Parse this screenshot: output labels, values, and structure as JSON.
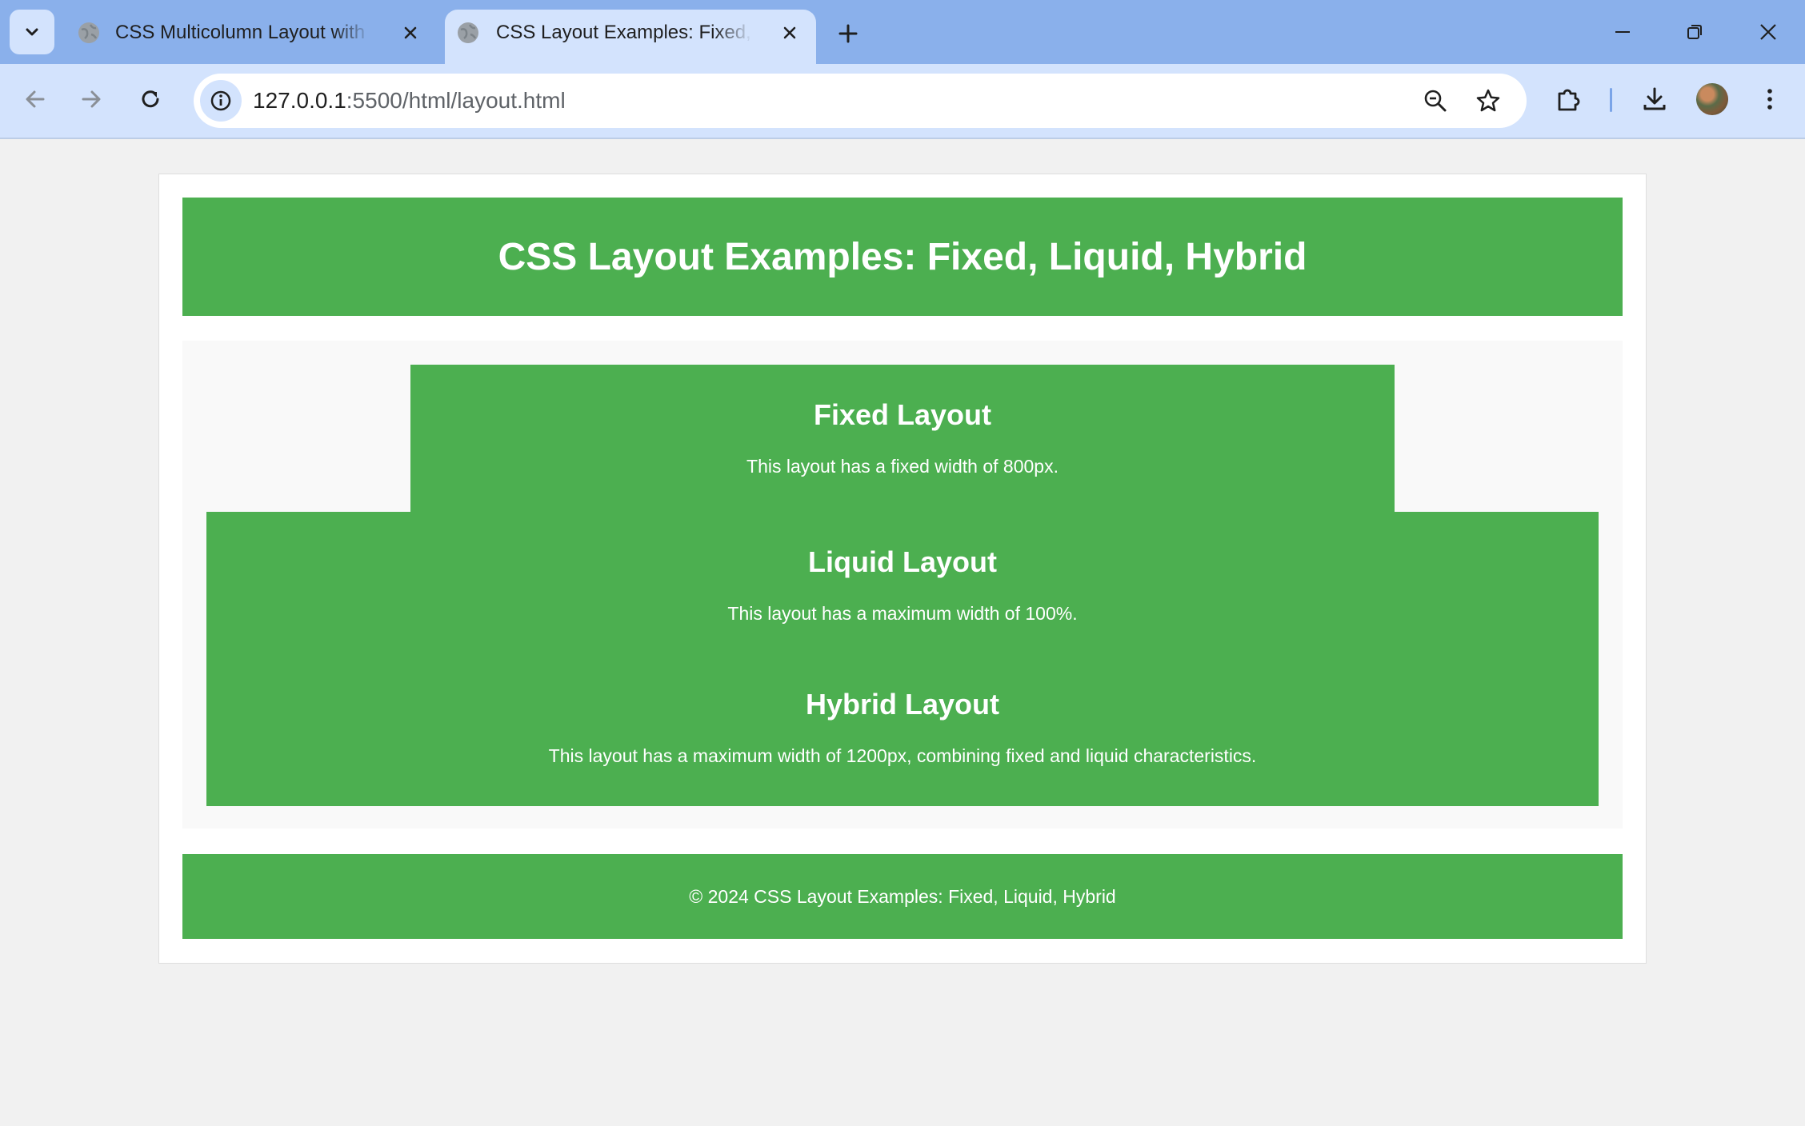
{
  "browser": {
    "tabs": [
      {
        "title": "CSS Multicolumn Layout with Fl",
        "active": false
      },
      {
        "title": "CSS Layout Examples: Fixed, Liq",
        "active": true
      }
    ],
    "url_host": "127.0.0.1",
    "url_path": ":5500/html/layout.html",
    "colors": {
      "tabstrip": "#8ab0eb",
      "toolbar": "#d3e3fd"
    }
  },
  "page": {
    "title": "CSS Layout Examples: Fixed, Liquid, Hybrid",
    "sections": {
      "fixed": {
        "heading": "Fixed Layout",
        "text": "This layout has a fixed width of 800px."
      },
      "liquid": {
        "heading": "Liquid Layout",
        "text": "This layout has a maximum width of 100%."
      },
      "hybrid": {
        "heading": "Hybrid Layout",
        "text": "This layout has a maximum width of 1200px, combining fixed and liquid characteristics."
      }
    },
    "footer": "© 2024 CSS Layout Examples: Fixed, Liquid, Hybrid",
    "colors": {
      "accent": "#4caf50",
      "background": "#f1f1f1"
    }
  }
}
